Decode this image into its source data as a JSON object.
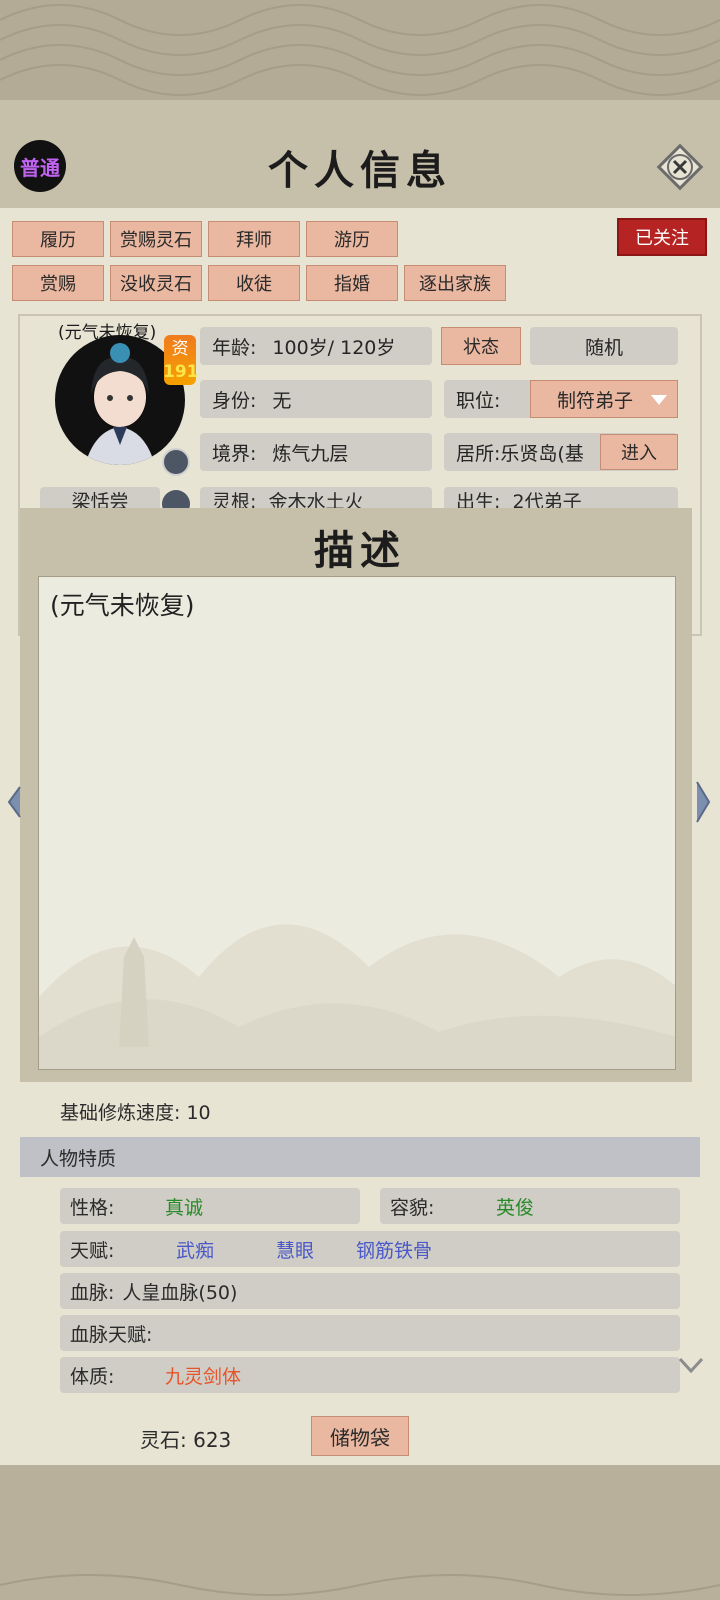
{
  "header": {
    "grade_badge": "普通",
    "title": "个人信息"
  },
  "actions": {
    "row1": [
      "履历",
      "赏赐灵石",
      "拜师",
      "游历"
    ],
    "row2": [
      "赏赐",
      "没收灵石",
      "收徒",
      "指婚",
      "逐出家族"
    ],
    "followed": "已关注"
  },
  "character": {
    "status_note": "(元气未恢复)",
    "aptitude_label": "资",
    "aptitude_value": "191",
    "name_partial": "梁恬尝",
    "age_label": "年龄:",
    "age_value": "100岁/ 120岁",
    "status_button": "状态",
    "random_button": "随机",
    "identity_label": "身份:",
    "identity_value": "无",
    "position_label": "职位:",
    "position_value": "制符弟子",
    "realm_label": "境界:",
    "realm_value": "炼气九层",
    "residence_label": "居所:",
    "residence_value": "乐贤岛(基",
    "enter_button": "进入",
    "root_label": "灵根:",
    "root_value": "金木水土火",
    "birth_label": "出生:",
    "birth_value": "2代弟子"
  },
  "description_dialog": {
    "title": "描述",
    "text": "(元气未恢复)"
  },
  "cultivation": {
    "speed_label": "基础修炼速度:",
    "speed_value": "10"
  },
  "traits": {
    "section_title": "人物特质",
    "personality_label": "性格:",
    "personality_value": "真诚",
    "appearance_label": "容貌:",
    "appearance_value": "英俊",
    "talent_label": "天赋:",
    "talents": [
      "武痴",
      "慧眼",
      "钢筋铁骨"
    ],
    "bloodline_label": "血脉:",
    "bloodline_value": "人皇血脉(50)",
    "bloodline_talent_label": "血脉天赋:",
    "physique_label": "体质:",
    "physique_value": "九灵剑体"
  },
  "footer": {
    "spirit_stone_label": "灵石:",
    "spirit_stone_value": "623",
    "bag_button": "储物袋"
  },
  "colors": {
    "button_fill": "#eab7a0",
    "followed_red": "#b62323",
    "green": "#2a8a2a",
    "blue": "#4a58c8",
    "orange": "#e8542a",
    "badge_purple": "#c063f0"
  }
}
